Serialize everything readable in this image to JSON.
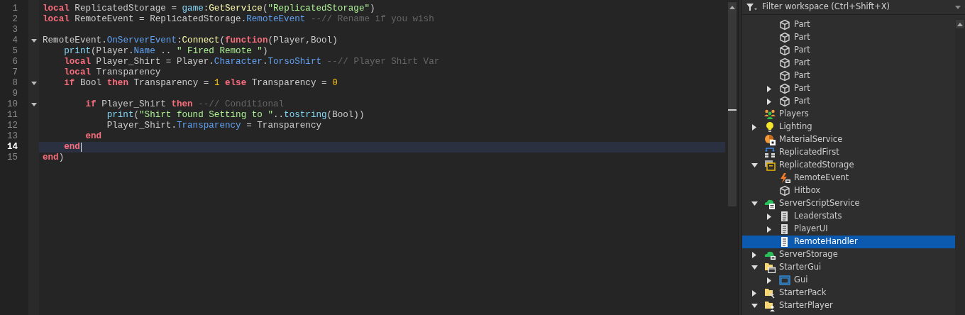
{
  "editor": {
    "lines": [
      {
        "number": "1",
        "current": false,
        "tokens": [
          {
            "kind": "keyword",
            "text": "local"
          },
          {
            "kind": "text",
            "text": " ReplicatedStorage = "
          },
          {
            "kind": "global",
            "text": "game"
          },
          {
            "kind": "text",
            "text": ":"
          },
          {
            "kind": "method",
            "text": "GetService"
          },
          {
            "kind": "text",
            "text": "("
          },
          {
            "kind": "string",
            "text": "\"ReplicatedStorage\""
          },
          {
            "kind": "text",
            "text": ")"
          }
        ]
      },
      {
        "number": "2",
        "current": false,
        "tokens": [
          {
            "kind": "keyword",
            "text": "local"
          },
          {
            "kind": "text",
            "text": " RemoteEvent = ReplicatedStorage."
          },
          {
            "kind": "property",
            "text": "RemoteEvent"
          },
          {
            "kind": "comment",
            "text": " --// Rename if you wish"
          }
        ]
      },
      {
        "number": "3",
        "current": false
      },
      {
        "number": "4",
        "fold": {
          "expanded": true
        },
        "current": false,
        "tokens": [
          {
            "kind": "text",
            "text": "RemoteEvent."
          },
          {
            "kind": "property",
            "text": "OnServerEvent"
          },
          {
            "kind": "text",
            "text": ":"
          },
          {
            "kind": "method",
            "text": "Connect"
          },
          {
            "kind": "text",
            "text": "("
          },
          {
            "kind": "keyword",
            "text": "function"
          },
          {
            "kind": "text",
            "text": "(Player,Bool)"
          }
        ]
      },
      {
        "number": "5",
        "current": false,
        "tokens": [
          {
            "kind": "global",
            "text": "    print"
          },
          {
            "kind": "text",
            "text": "(Player."
          },
          {
            "kind": "property",
            "text": "Name"
          },
          {
            "kind": "text",
            "text": " .. "
          },
          {
            "kind": "string",
            "text": "\" Fired Remote \""
          },
          {
            "kind": "text",
            "text": ")"
          }
        ]
      },
      {
        "number": "6",
        "current": false,
        "tokens": [
          {
            "kind": "keyword",
            "text": "    local"
          },
          {
            "kind": "text",
            "text": " Player_Shirt = Player."
          },
          {
            "kind": "property",
            "text": "Character"
          },
          {
            "kind": "text",
            "text": "."
          },
          {
            "kind": "property",
            "text": "TorsoShirt"
          },
          {
            "kind": "comment",
            "text": " --// Player Shirt Var"
          }
        ]
      },
      {
        "number": "7",
        "current": false,
        "tokens": [
          {
            "kind": "keyword",
            "text": "    local"
          },
          {
            "kind": "text",
            "text": " Transparency"
          }
        ]
      },
      {
        "number": "8",
        "fold": {
          "expanded": true
        },
        "current": false,
        "tokens": [
          {
            "kind": "keyword",
            "text": "    if"
          },
          {
            "kind": "text",
            "text": " Bool "
          },
          {
            "kind": "keyword",
            "text": "then"
          },
          {
            "kind": "text",
            "text": " Transparency = "
          },
          {
            "kind": "number",
            "text": "1"
          },
          {
            "kind": "keyword",
            "text": " else"
          },
          {
            "kind": "text",
            "text": " Transparency = "
          },
          {
            "kind": "number",
            "text": "0"
          }
        ]
      },
      {
        "number": "9",
        "current": false
      },
      {
        "number": "10",
        "fold": {
          "expanded": true
        },
        "current": false,
        "tokens": [
          {
            "kind": "keyword",
            "text": "        if"
          },
          {
            "kind": "text",
            "text": " Player_Shirt "
          },
          {
            "kind": "keyword",
            "text": "then"
          },
          {
            "kind": "comment",
            "text": " --// Conditional"
          }
        ]
      },
      {
        "number": "11",
        "current": false,
        "tokens": [
          {
            "kind": "global",
            "text": "            print"
          },
          {
            "kind": "text",
            "text": "("
          },
          {
            "kind": "string",
            "text": "\"Shirt found Setting to \""
          },
          {
            "kind": "text",
            "text": ".."
          },
          {
            "kind": "global",
            "text": "tostring"
          },
          {
            "kind": "text",
            "text": "(Bool))"
          }
        ]
      },
      {
        "number": "12",
        "current": false,
        "tokens": [
          {
            "kind": "text",
            "text": "            Player_Shirt."
          },
          {
            "kind": "property",
            "text": "Transparency"
          },
          {
            "kind": "text",
            "text": " = Transparency"
          }
        ]
      },
      {
        "number": "13",
        "current": false,
        "tokens": [
          {
            "kind": "keyword",
            "text": "        end"
          }
        ]
      },
      {
        "number": "14",
        "current": true,
        "tokens": [
          {
            "kind": "keyword",
            "text": "    end"
          }
        ]
      },
      {
        "number": "15",
        "current": false,
        "tokens": [
          {
            "kind": "keyword",
            "text": "end"
          },
          {
            "kind": "text",
            "text": ")"
          }
        ]
      }
    ]
  },
  "explorer": {
    "filter": {
      "placeholder": "Filter workspace (Ctrl+Shift+X)"
    },
    "items": [
      {
        "children": [
          {
            "label": "Part",
            "kind": "part",
            "expandable": false,
            "selected": false
          },
          {
            "label": "Part",
            "kind": "part",
            "expandable": false,
            "selected": false
          },
          {
            "label": "Part",
            "kind": "part",
            "expandable": false,
            "selected": false
          },
          {
            "label": "Part",
            "kind": "part",
            "expandable": false,
            "selected": false
          },
          {
            "label": "Part",
            "kind": "part",
            "expandable": false,
            "selected": false
          },
          {
            "label": "Part",
            "kind": "part",
            "expandable": true,
            "expanded": false,
            "selected": false
          },
          {
            "label": "Part",
            "kind": "part",
            "expandable": true,
            "expanded": false,
            "selected": false
          }
        ]
      },
      {
        "label": "Players",
        "kind": "players",
        "expandable": false,
        "selected": false
      },
      {
        "label": "Lighting",
        "kind": "lighting",
        "expandable": true,
        "expanded": false,
        "selected": false
      },
      {
        "label": "MaterialService",
        "kind": "material",
        "expandable": false,
        "selected": false
      },
      {
        "label": "ReplicatedFirst",
        "kind": "replicated-first",
        "expandable": false,
        "selected": false
      },
      {
        "label": "ReplicatedStorage",
        "kind": "replicated-storage",
        "expandable": true,
        "expanded": true,
        "selected": false,
        "children": [
          {
            "label": "RemoteEvent",
            "kind": "remote-event",
            "expandable": false,
            "selected": false
          },
          {
            "label": "Hitbox",
            "kind": "part",
            "expandable": false,
            "selected": false
          }
        ]
      },
      {
        "label": "ServerScriptService",
        "kind": "server-script-service",
        "expandable": true,
        "expanded": true,
        "selected": false,
        "children": [
          {
            "label": "Leaderstats",
            "kind": "script",
            "expandable": true,
            "expanded": false,
            "selected": false
          },
          {
            "label": "PlayerUI",
            "kind": "script",
            "expandable": true,
            "expanded": false,
            "selected": false
          },
          {
            "label": "RemoteHandler",
            "kind": "script",
            "expandable": false,
            "selected": true
          }
        ]
      },
      {
        "label": "ServerStorage",
        "kind": "server-storage",
        "expandable": true,
        "expanded": false,
        "selected": false
      },
      {
        "label": "StarterGui",
        "kind": "starter-gui",
        "expandable": true,
        "expanded": true,
        "selected": false,
        "children": [
          {
            "label": "Gui",
            "kind": "gui",
            "expandable": true,
            "expanded": false,
            "selected": false
          }
        ]
      },
      {
        "label": "StarterPack",
        "kind": "starter-pack",
        "expandable": true,
        "expanded": false,
        "selected": false
      },
      {
        "label": "StarterPlayer",
        "kind": "starter-player",
        "expandable": true,
        "expanded": true,
        "selected": false
      }
    ]
  }
}
